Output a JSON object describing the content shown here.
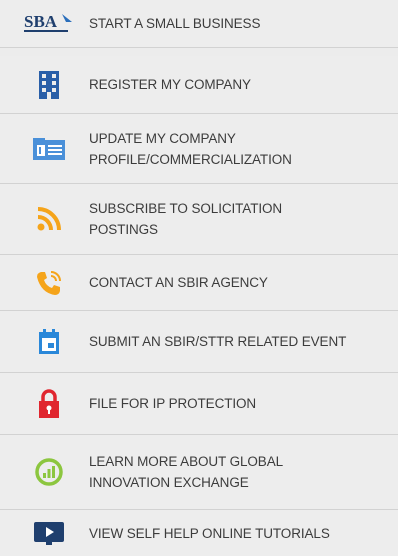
{
  "menu": {
    "items": [
      {
        "label": "START A SMALL BUSINESS",
        "icon": "sba-logo-icon",
        "logo_text": "SBA"
      },
      {
        "label": "REGISTER MY COMPANY",
        "icon": "building-icon"
      },
      {
        "label": "UPDATE MY COMPANY\nPROFILE/COMMERCIALIZATION",
        "icon": "profile-card-icon"
      },
      {
        "label": "SUBSCRIBE TO SOLICITATION\nPOSTINGS",
        "icon": "rss-icon"
      },
      {
        "label": "CONTACT AN SBIR AGENCY",
        "icon": "phone-icon"
      },
      {
        "label": "SUBMIT AN SBIR/STTR RELATED EVENT",
        "icon": "calendar-icon"
      },
      {
        "label": "FILE FOR IP PROTECTION",
        "icon": "lock-icon"
      },
      {
        "label": "LEARN MORE ABOUT GLOBAL\nINNOVATION EXCHANGE",
        "icon": "growth-chart-icon"
      },
      {
        "label": "VIEW SELF HELP ONLINE TUTORIALS",
        "icon": "video-play-icon"
      }
    ]
  },
  "colors": {
    "navy": "#1f3f6e",
    "blue": "#2a6ebb",
    "light_blue": "#4a90d9",
    "orange": "#f5a41a",
    "red": "#e0262f",
    "green": "#8cc63f"
  }
}
